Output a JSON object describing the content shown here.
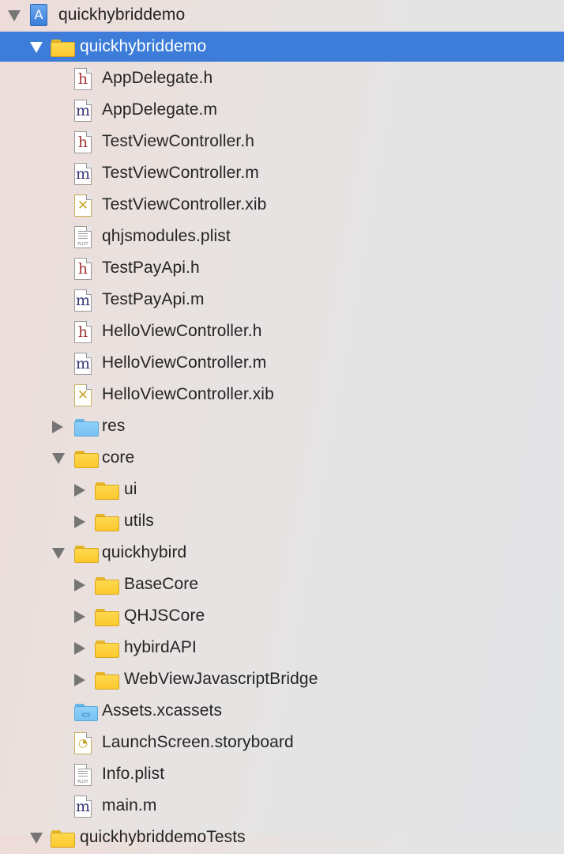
{
  "navigator": {
    "items": [
      {
        "label": "quickhybriddemo",
        "depth": 0,
        "kind": "project",
        "disclosure": "expanded",
        "selected": false
      },
      {
        "label": "quickhybriddemo",
        "depth": 1,
        "kind": "folder",
        "disclosure": "expanded",
        "selected": true
      },
      {
        "label": "AppDelegate.h",
        "depth": 2,
        "kind": "h",
        "disclosure": "none"
      },
      {
        "label": "AppDelegate.m",
        "depth": 2,
        "kind": "m",
        "disclosure": "none"
      },
      {
        "label": "TestViewController.h",
        "depth": 2,
        "kind": "h",
        "disclosure": "none"
      },
      {
        "label": "TestViewController.m",
        "depth": 2,
        "kind": "m",
        "disclosure": "none"
      },
      {
        "label": "TestViewController.xib",
        "depth": 2,
        "kind": "xib",
        "disclosure": "none"
      },
      {
        "label": "qhjsmodules.plist",
        "depth": 2,
        "kind": "plist",
        "disclosure": "none"
      },
      {
        "label": "TestPayApi.h",
        "depth": 2,
        "kind": "h",
        "disclosure": "none"
      },
      {
        "label": "TestPayApi.m",
        "depth": 2,
        "kind": "m",
        "disclosure": "none"
      },
      {
        "label": "HelloViewController.h",
        "depth": 2,
        "kind": "h",
        "disclosure": "none"
      },
      {
        "label": "HelloViewController.m",
        "depth": 2,
        "kind": "m",
        "disclosure": "none"
      },
      {
        "label": "HelloViewController.xib",
        "depth": 2,
        "kind": "xib",
        "disclosure": "none"
      },
      {
        "label": "res",
        "depth": 2,
        "kind": "folder-blue",
        "disclosure": "collapsed"
      },
      {
        "label": "core",
        "depth": 2,
        "kind": "folder",
        "disclosure": "expanded"
      },
      {
        "label": "ui",
        "depth": 3,
        "kind": "folder",
        "disclosure": "collapsed"
      },
      {
        "label": "utils",
        "depth": 3,
        "kind": "folder",
        "disclosure": "collapsed"
      },
      {
        "label": "quickhybird",
        "depth": 2,
        "kind": "folder",
        "disclosure": "expanded"
      },
      {
        "label": "BaseCore",
        "depth": 3,
        "kind": "folder",
        "disclosure": "collapsed"
      },
      {
        "label": "QHJSCore",
        "depth": 3,
        "kind": "folder",
        "disclosure": "collapsed"
      },
      {
        "label": "hybirdAPI",
        "depth": 3,
        "kind": "folder",
        "disclosure": "collapsed"
      },
      {
        "label": "WebViewJavascriptBridge",
        "depth": 3,
        "kind": "folder",
        "disclosure": "collapsed"
      },
      {
        "label": "Assets.xcassets",
        "depth": 2,
        "kind": "assets",
        "disclosure": "none"
      },
      {
        "label": "LaunchScreen.storyboard",
        "depth": 2,
        "kind": "storyboard",
        "disclosure": "none"
      },
      {
        "label": "Info.plist",
        "depth": 2,
        "kind": "plist",
        "disclosure": "none"
      },
      {
        "label": "main.m",
        "depth": 2,
        "kind": "m",
        "disclosure": "none"
      },
      {
        "label": "quickhybriddemoTests",
        "depth": 1,
        "kind": "folder",
        "disclosure": "expanded"
      }
    ]
  },
  "glyphs": {
    "h": "h",
    "m": "m",
    "xib": "✕",
    "plist_caption": "PLIST",
    "storyboard": "◔",
    "project": "A",
    "assets": "▭"
  },
  "colors": {
    "selection": "#3d7dd9",
    "text": "#242424",
    "folder": "#fbc92d",
    "folder_blue": "#79c2f2"
  }
}
